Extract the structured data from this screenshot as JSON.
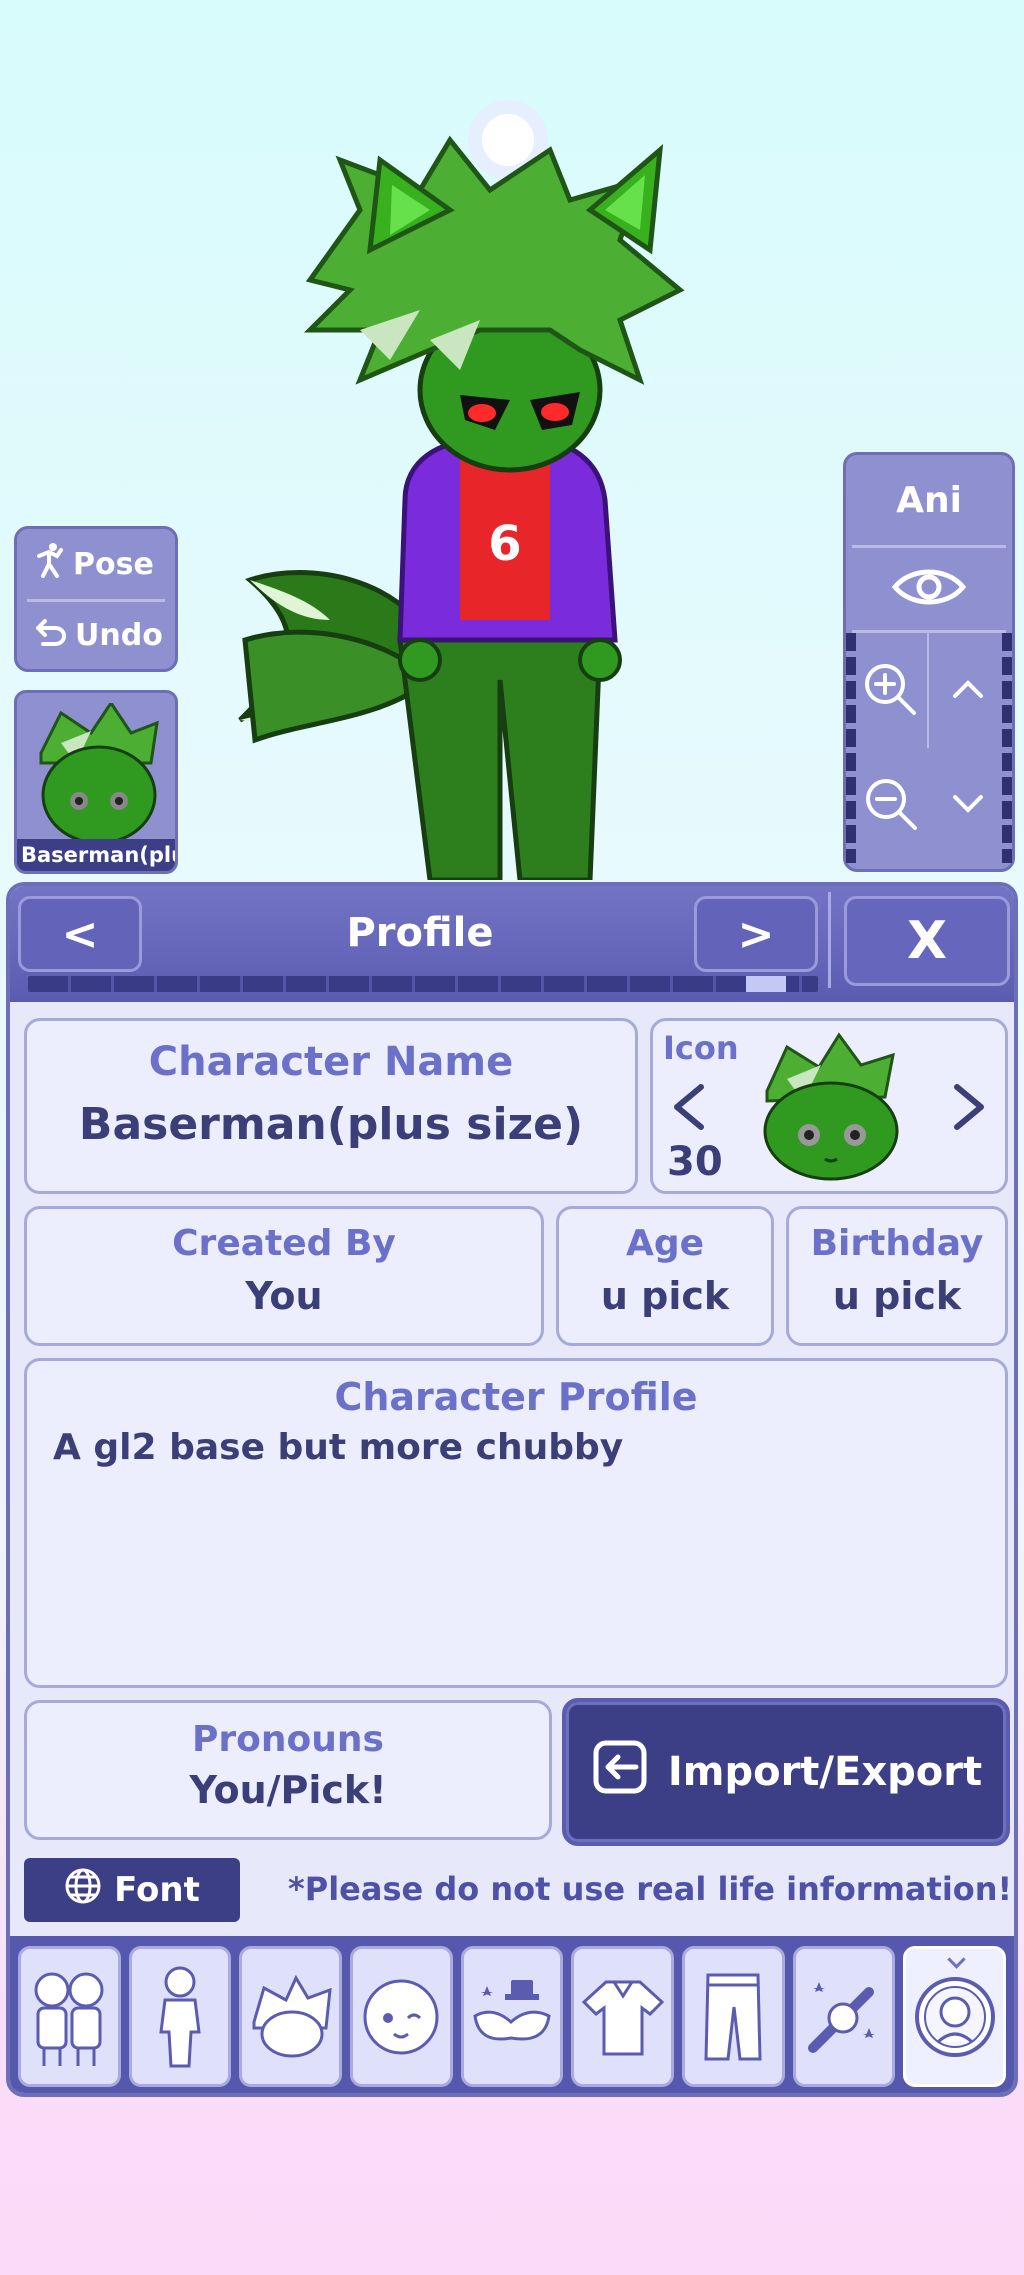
{
  "stage": {
    "pose_label": "Pose",
    "undo_label": "Undo",
    "ani_label": "Ani",
    "character_thumb_label": "Baserman(plu"
  },
  "profile_panel": {
    "title": "Profile",
    "prev_label": "<",
    "next_label": ">",
    "close_label": "X",
    "page_progress": 0.96,
    "character_name": {
      "label": "Character Name",
      "value": "Baserman(plus size)"
    },
    "icon": {
      "label": "Icon",
      "prev": "<",
      "next": ">",
      "number": "30"
    },
    "created_by": {
      "label": "Created By",
      "value": "You"
    },
    "age": {
      "label": "Age",
      "value": "u pick"
    },
    "birthday": {
      "label": "Birthday",
      "value": "u pick"
    },
    "character_profile": {
      "label": "Character Profile",
      "value": "A gl2 base but more chubby"
    },
    "pronouns": {
      "label": "Pronouns",
      "value": "You/Pick!"
    },
    "import_export_label": "Import/Export",
    "font_label": "Font",
    "warning": "*Please do not use real life information!"
  },
  "tabs": [
    {
      "icon": "group-icon"
    },
    {
      "icon": "body-icon"
    },
    {
      "icon": "hair-icon"
    },
    {
      "icon": "face-icon"
    },
    {
      "icon": "accessory-icon"
    },
    {
      "icon": "top-clothing-icon"
    },
    {
      "icon": "bottom-clothing-icon"
    },
    {
      "icon": "prop-icon"
    },
    {
      "icon": "profile-icon",
      "active": true
    }
  ],
  "colors": {
    "panel_dark": "#3d3f86",
    "panel_mid": "#5b5cb0",
    "label_blue": "#6b70c9",
    "progress_fill": "#c3c8f5",
    "skin_green": "#2f9a1f",
    "hoodie_purple": "#7a2bdc",
    "shirt_red": "#e8262a"
  }
}
